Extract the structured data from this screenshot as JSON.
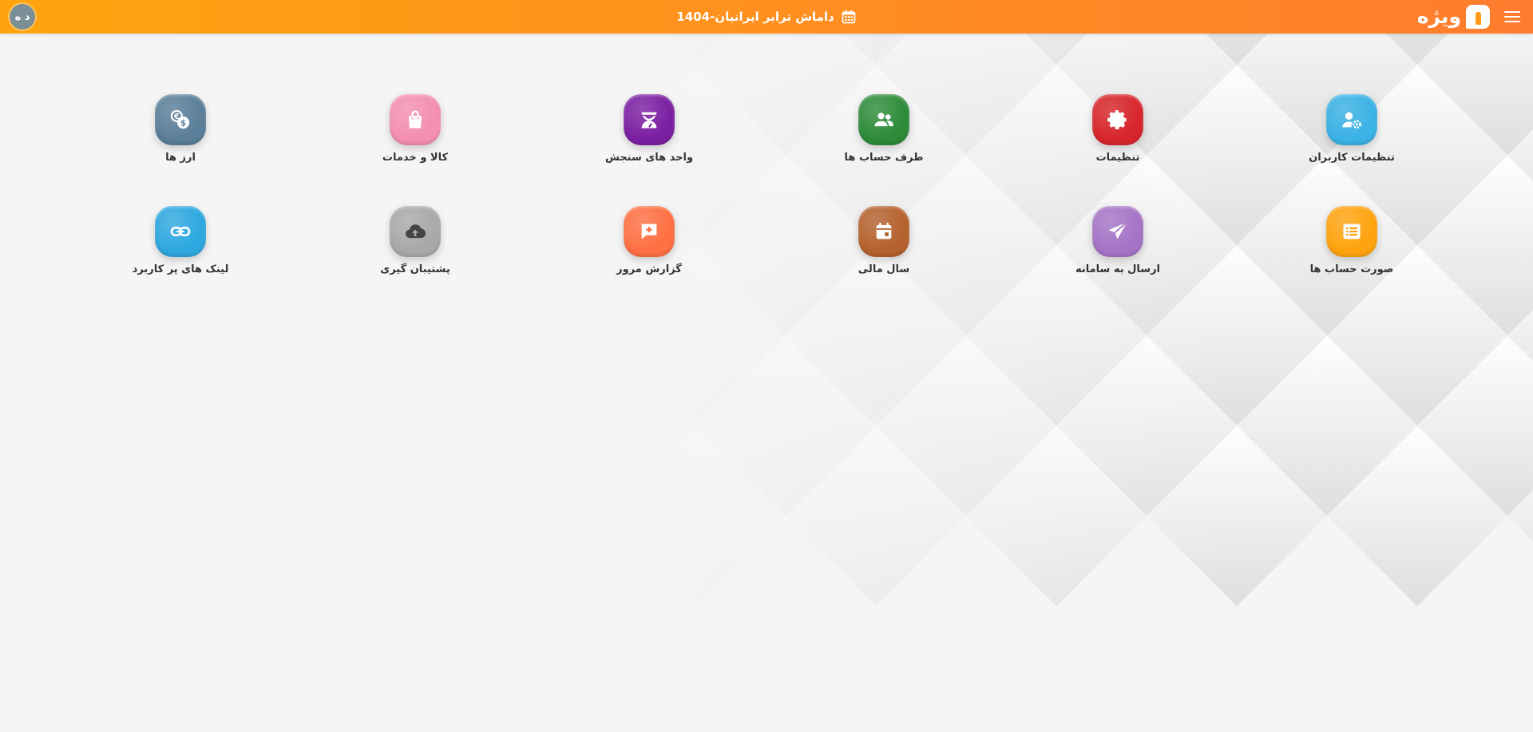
{
  "header": {
    "logo_text": "ویژه",
    "title": "داماش ترابر ایرانیان-1404",
    "avatar_initials": "د ه"
  },
  "colors": {
    "header_start": "#ffa40f",
    "header_end": "#ff7c2e"
  },
  "tiles": [
    {
      "label": "تنظیمات کاربران",
      "icon": "user-settings-icon",
      "color": "#3bb3e6"
    },
    {
      "label": "تنظیمات",
      "icon": "gear-icon",
      "color": "#d7262b"
    },
    {
      "label": "طرف حساب ها",
      "icon": "people-icon",
      "color": "#2e8b3a"
    },
    {
      "label": "واحد های سنجش",
      "icon": "scale-icon",
      "color": "#7b1fa2"
    },
    {
      "label": "کالا و خدمات",
      "icon": "shopping-bag-icon",
      "color": "#f48fb1"
    },
    {
      "label": "ارز ها",
      "icon": "currency-coins-icon",
      "color": "#5b7f9a"
    },
    {
      "label": "صورت حساب ها",
      "icon": "invoice-list-icon",
      "color": "#ffa40f"
    },
    {
      "label": "ارسال به سامانه",
      "icon": "send-plane-icon",
      "color": "#a674c7"
    },
    {
      "label": "سال مالی",
      "icon": "calendar-icon",
      "color": "#b5622e"
    },
    {
      "label": "گزارش مرور",
      "icon": "report-comment-icon",
      "color": "#ff7043"
    },
    {
      "label": "پشتیبان گیری",
      "icon": "cloud-upload-icon",
      "color": "#a9a9a9"
    },
    {
      "label": "لینک های پر کاربرد",
      "icon": "link-icon",
      "color": "#2ea8e0"
    }
  ]
}
